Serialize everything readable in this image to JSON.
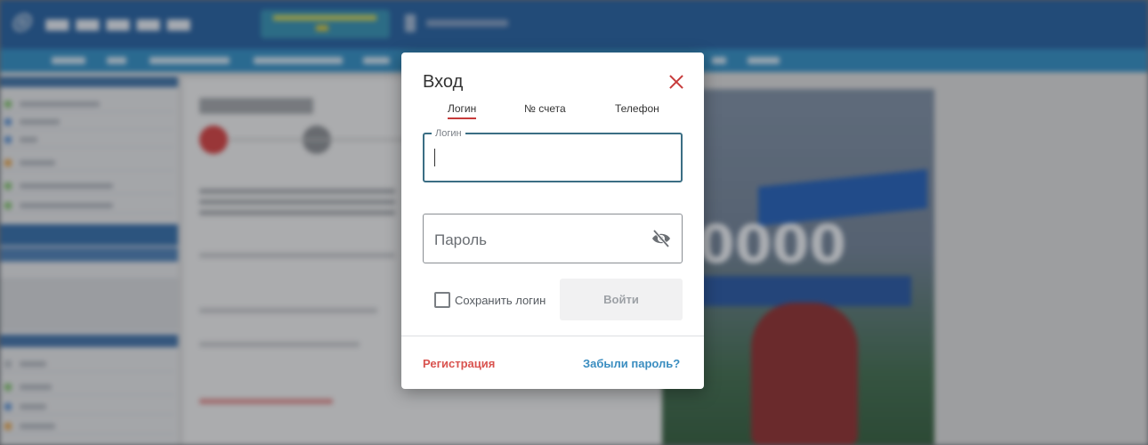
{
  "modal": {
    "title": "Вход",
    "tabs": [
      {
        "label": "Логин",
        "active": true
      },
      {
        "label": "№ счета",
        "active": false
      },
      {
        "label": "Телефон",
        "active": false
      }
    ],
    "login_field": {
      "legend": "Логин",
      "value": ""
    },
    "password_field": {
      "placeholder": "Пароль",
      "value": ""
    },
    "remember": {
      "label": "Сохранить логин",
      "checked": false
    },
    "login_button": "Войти",
    "register_link": "Регистрация",
    "forgot_link": "Забыли пароль?"
  },
  "icons": [
    "close-icon",
    "eye-off-icon",
    "checkbox-icon"
  ],
  "colors": {
    "accent_red": "#c73a3a",
    "link_red": "#d9534f",
    "link_blue": "#3a8dc0",
    "focus_border": "#3b6e84",
    "header_blue": "#1f5c9e",
    "nav_blue": "#2c8cc4"
  }
}
